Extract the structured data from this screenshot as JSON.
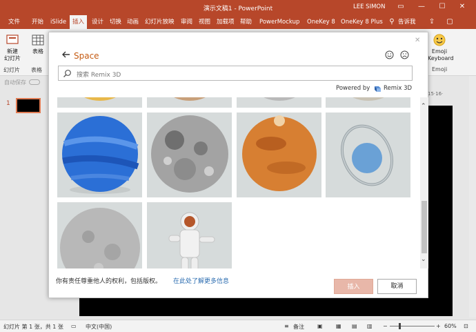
{
  "window": {
    "title": "演示文稿1  -  PowerPoint",
    "user": "LEE SIMON"
  },
  "ribbon_tabs": [
    "文件",
    "开始",
    "iSlide",
    "插入",
    "设计",
    "切换",
    "动画",
    "幻灯片放映",
    "审阅",
    "视图",
    "加载项",
    "帮助",
    "PowerMockup",
    "OneKey 8",
    "OneKey 8 Plus"
  ],
  "ribbon_active_tab": "插入",
  "tell_me": "告诉我",
  "ribbon": {
    "new_slide": "新建\n幻灯片",
    "table": "表格",
    "group_slides": "幻灯片",
    "group_table": "表格",
    "emoji_keyboard": "Emoji\nKeyboard",
    "group_emoji": "Emoji"
  },
  "left_pane": {
    "autosave": "自动保存",
    "slide_number": "1"
  },
  "ruler_text": "15·16·",
  "dialog": {
    "title": "Space",
    "search_placeholder": "搜索 Remix 3D",
    "powered_by": "Powered by",
    "powered_brand": "Remix 3D",
    "footer_note": "你有责任尊重他人的权利，包括版权。",
    "footer_link": "在此处了解更多信息",
    "insert_button": "插入",
    "cancel_button": "取消"
  },
  "models": [
    {
      "name": "planet-neptune",
      "color": "#2b6fd6"
    },
    {
      "name": "moon",
      "color": "#9a9a9a"
    },
    {
      "name": "planet-mars",
      "color": "#d77f32"
    },
    {
      "name": "planet-uranus",
      "color": "#6aa1d6"
    },
    {
      "name": "planet-mercury",
      "color": "#b8b8b8"
    },
    {
      "name": "astronaut",
      "color": "#eeeeee"
    }
  ],
  "statusbar": {
    "slide_info": "幻灯片 第 1 张，共 1 张",
    "language": "中文(中国)",
    "notes": "备注",
    "zoom": "60%"
  }
}
